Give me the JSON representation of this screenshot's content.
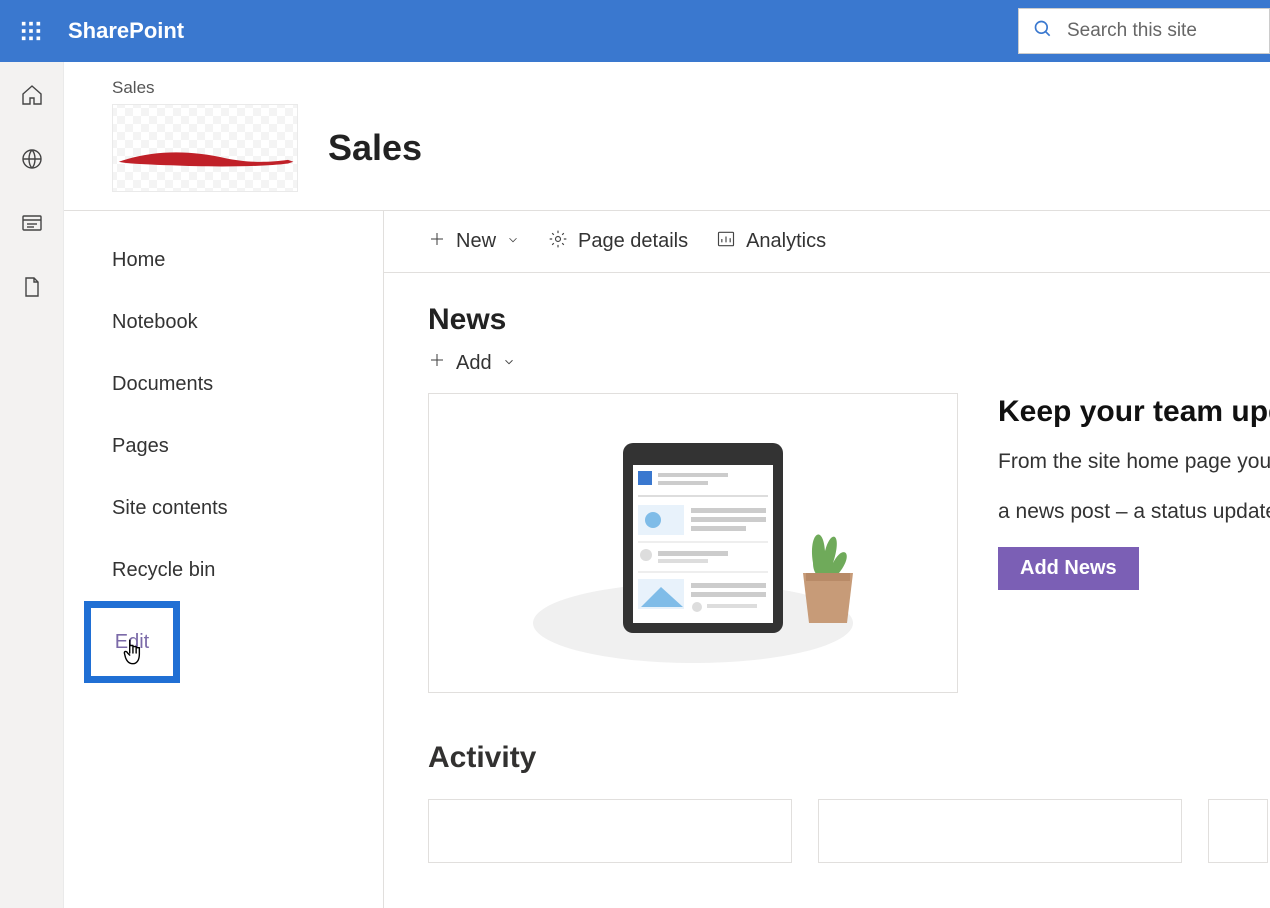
{
  "suite": {
    "brand": "SharePoint",
    "search_placeholder": "Search this site"
  },
  "rail": {
    "items": [
      "home-icon",
      "global-icon",
      "news-icon",
      "file-icon"
    ]
  },
  "site": {
    "breadcrumb": "Sales",
    "title": "Sales"
  },
  "nav": {
    "items": [
      {
        "label": "Home"
      },
      {
        "label": "Notebook"
      },
      {
        "label": "Documents"
      },
      {
        "label": "Pages"
      },
      {
        "label": "Site contents"
      },
      {
        "label": "Recycle bin"
      }
    ],
    "edit_label": "Edit"
  },
  "commands": {
    "new_label": "New",
    "page_details_label": "Page details",
    "analytics_label": "Analytics"
  },
  "news": {
    "section_title": "News",
    "add_label": "Add",
    "heading_line": "Keep your team updated with news on your team site",
    "desc_line1": "From the site home page you'll be able to quickly author",
    "desc_line2": "a news post – a status update, trip report, or more.",
    "add_news_btn": "Add News"
  },
  "activity": {
    "title": "Activity"
  },
  "colors": {
    "brand_blue": "#3a78cf",
    "accent_purple": "#7b5fb5",
    "highlight_border": "#206fd4"
  }
}
